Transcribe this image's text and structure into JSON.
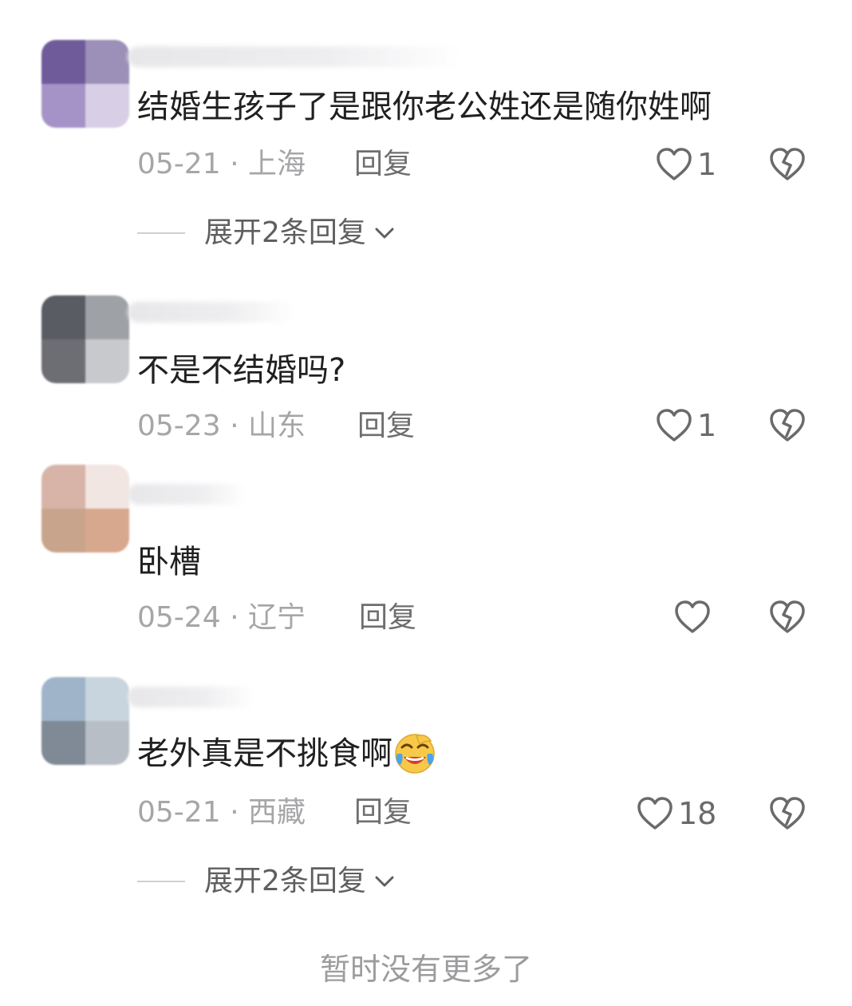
{
  "comments": [
    {
      "text": "结婚生孩子了是跟你老公姓还是随你姓啊",
      "date": "05-21",
      "location": "上海",
      "reply_label": "回复",
      "likes": "1",
      "expand_label": "展开2条回复",
      "avatar_colors": [
        "#6f5a9a",
        "#9c8fb8",
        "#a593c8",
        "#d8cfe6"
      ]
    },
    {
      "text": "不是不结婚吗?",
      "date": "05-23",
      "location": "山东",
      "reply_label": "回复",
      "likes": "1",
      "avatar_colors": [
        "#5a5c63",
        "#9ea2a6",
        "#6c6e73",
        "#c8c9cc"
      ]
    },
    {
      "text": "卧槽",
      "date": "05-24",
      "location": "辽宁",
      "reply_label": "回复",
      "likes": "",
      "avatar_colors": [
        "#d8b4a8",
        "#f2e6e2",
        "#c9a48c",
        "#d8a88e"
      ]
    },
    {
      "text": "老外真是不挑食啊",
      "emoji": "laughing-crying-emoji",
      "date": "05-21",
      "location": "西藏",
      "reply_label": "回复",
      "likes": "18",
      "expand_label": "展开2条回复",
      "avatar_colors": [
        "#9fb4c8",
        "#c8d4de",
        "#7f8a96",
        "#b8bec6"
      ]
    }
  ],
  "footer": {
    "text": "暂时没有更多了"
  },
  "colors": {
    "text_primary": "#202020",
    "text_meta": "#a6a6a8",
    "text_reply": "#6e6e70",
    "icon_stroke": "#6a6a6c"
  },
  "icons": {
    "like": "heart-icon",
    "dislike": "broken-heart-icon",
    "expand": "chevron-down-icon"
  }
}
